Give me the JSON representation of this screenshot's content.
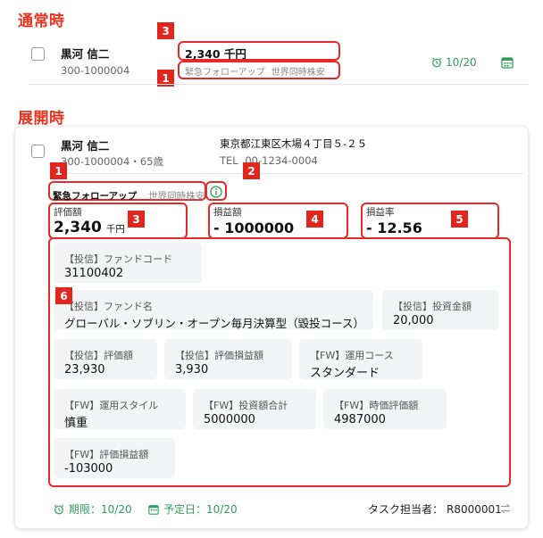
{
  "normal": {
    "title": "通常時",
    "row": {
      "name": "黒河 信二",
      "id": "300-1000004",
      "valuation": "2,340 千円",
      "tag_main": "緊急フォローアップ",
      "tag_sub": "世界同時株安",
      "deadline": "10/20"
    },
    "markers": [
      "3",
      "1"
    ]
  },
  "expanded": {
    "title": "展開時",
    "customer": {
      "name": "黒河 信二",
      "id_age": "300-1000004・65歳",
      "address": "東京都江東区木場４丁目５-２５",
      "tel_prefix": "TEL",
      "tel": "00-1234-0004"
    },
    "tag_main": "緊急フォローアップ",
    "tag_sub": "世界同時株安",
    "info_icon": "info-icon",
    "metrics": {
      "valuation_label": "評価額",
      "valuation_value": "2,340",
      "valuation_unit": "千円",
      "pl_label": "損益額",
      "pl_value": "- 1000000",
      "rate_label": "損益率",
      "rate_value": "- 12.56"
    },
    "fields": [
      {
        "label": "【投信】ファンドコード",
        "value": "31100402"
      },
      {
        "label": "【投信】ファンド名",
        "value": "グローバル・ソブリン・オープン毎月決算型（毀投コース）"
      },
      {
        "label": "【投信】投資金額",
        "value": "20,000"
      },
      {
        "label": "【投信】評価額",
        "value": "23,930"
      },
      {
        "label": "【投信】評価損益額",
        "value": "3,930"
      },
      {
        "label": "【FW】運用コース",
        "value": "スタンダード"
      },
      {
        "label": "【FW】運用スタイル",
        "value": "慎重"
      },
      {
        "label": "【FW】投資額合計",
        "value": "5000000"
      },
      {
        "label": "【FW】時価評価額",
        "value": "4987000"
      },
      {
        "label": "【FW】評価損益額",
        "value": "-103000"
      }
    ],
    "footer": {
      "deadline": "期限：10/20",
      "scheduled": "予定日：10/20",
      "assignee_label": "タスク担当者：",
      "assignee": "R8000001"
    },
    "markers": [
      "1",
      "2",
      "3",
      "4",
      "5",
      "6"
    ]
  },
  "colors": {
    "accent_red": "#e62a2a",
    "title_red": "#e8321e",
    "green": "#2f9e5c"
  }
}
